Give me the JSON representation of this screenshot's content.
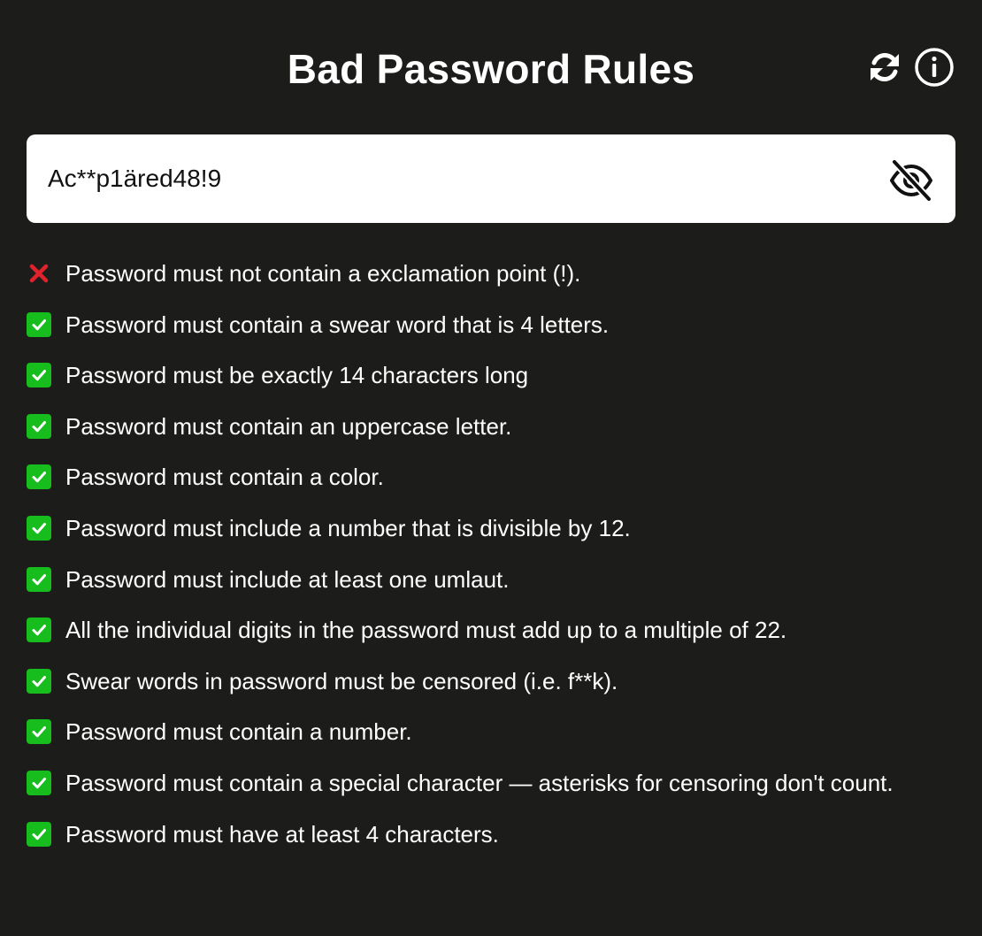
{
  "header": {
    "title": "Bad Password Rules",
    "refresh_icon": "refresh-icon",
    "info_icon": "info-icon"
  },
  "password": {
    "value": "Ac**p1äred48!9",
    "visibility_icon": "eye-off-icon"
  },
  "colors": {
    "background": "#1c1d1b",
    "pass": "#16bd1c",
    "fail": "#e0222c"
  },
  "rules": [
    {
      "text": "Password must not contain a exclamation point (!).",
      "status": "fail",
      "icon": "cross-icon"
    },
    {
      "text": "Password must contain a swear word that is 4 letters.",
      "status": "pass",
      "icon": "check-icon"
    },
    {
      "text": "Password must be exactly 14 characters long",
      "status": "pass",
      "icon": "check-icon"
    },
    {
      "text": "Password must contain an uppercase letter.",
      "status": "pass",
      "icon": "check-icon"
    },
    {
      "text": "Password must contain a color.",
      "status": "pass",
      "icon": "check-icon"
    },
    {
      "text": "Password must include a number that is divisible by 12.",
      "status": "pass",
      "icon": "check-icon"
    },
    {
      "text": "Password must include at least one umlaut.",
      "status": "pass",
      "icon": "check-icon"
    },
    {
      "text": "All the individual digits in the password must add up to a multiple of 22.",
      "status": "pass",
      "icon": "check-icon"
    },
    {
      "text": "Swear words in password must be censored (i.e. f**k).",
      "status": "pass",
      "icon": "check-icon"
    },
    {
      "text": "Password must contain a number.",
      "status": "pass",
      "icon": "check-icon"
    },
    {
      "text": "Password must contain a special character — asterisks for censoring don't count.",
      "status": "pass",
      "icon": "check-icon"
    },
    {
      "text": "Password must have at least 4 characters.",
      "status": "pass",
      "icon": "check-icon"
    }
  ]
}
